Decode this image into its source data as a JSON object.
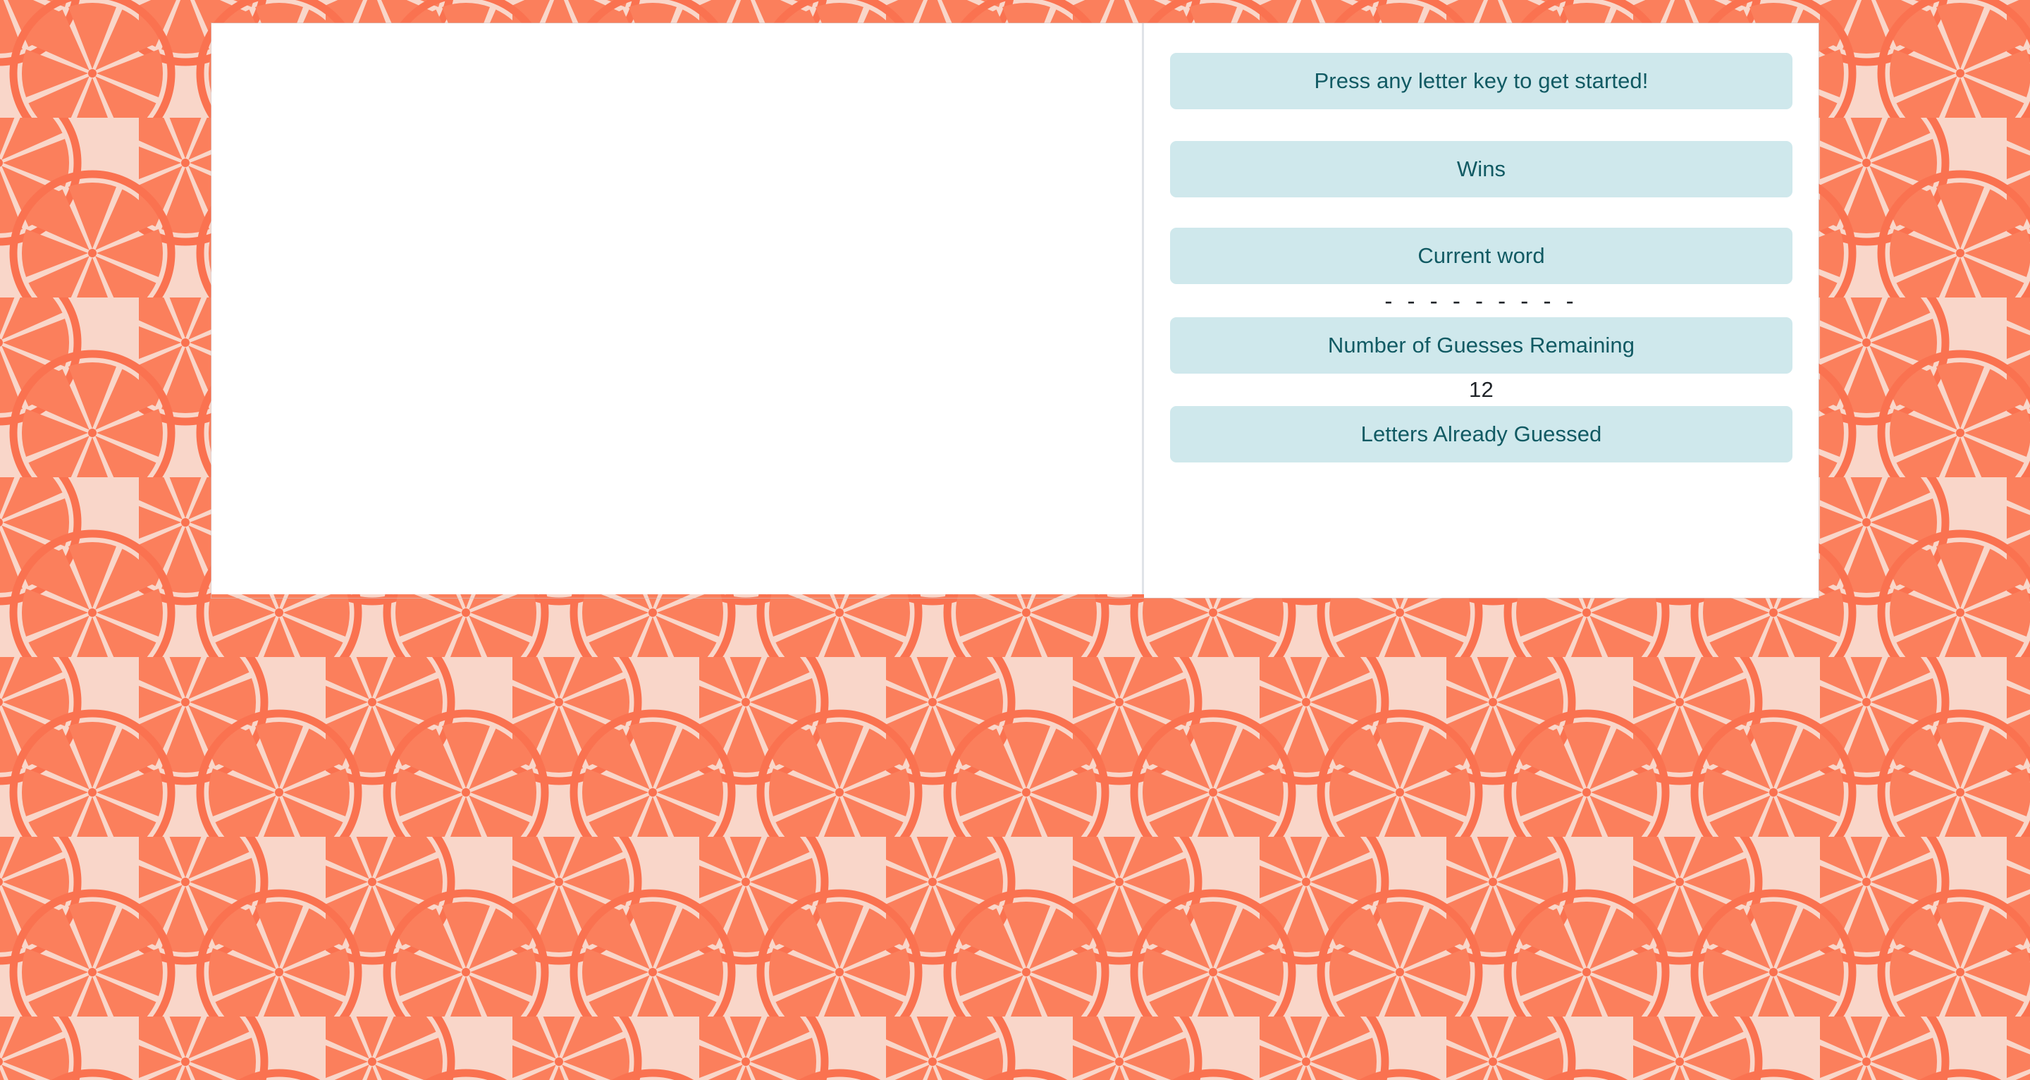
{
  "theme": {
    "page_background_color": "#f9d6c9",
    "pattern_accent_color": "#fa7250",
    "pattern_wedge_color": "#fb7f5c",
    "card_background_color": "#ffffff",
    "label_bar_color": "#cfe8ec",
    "label_text_color": "#115a63",
    "value_text_color": "#1f2328",
    "divider_color": "#dfe3e8"
  },
  "game": {
    "stage_label": "game-stage",
    "prompt": "Press any letter key to get started!",
    "wins_label": "Wins",
    "wins_value": "",
    "current_word_label": "Current word",
    "current_word_value": "- - - - - - - - -",
    "guesses_remaining_label": "Number of Guesses Remaining",
    "guesses_remaining_value": "12",
    "letters_guessed_label": "Letters Already Guessed",
    "letters_guessed_value": ""
  }
}
